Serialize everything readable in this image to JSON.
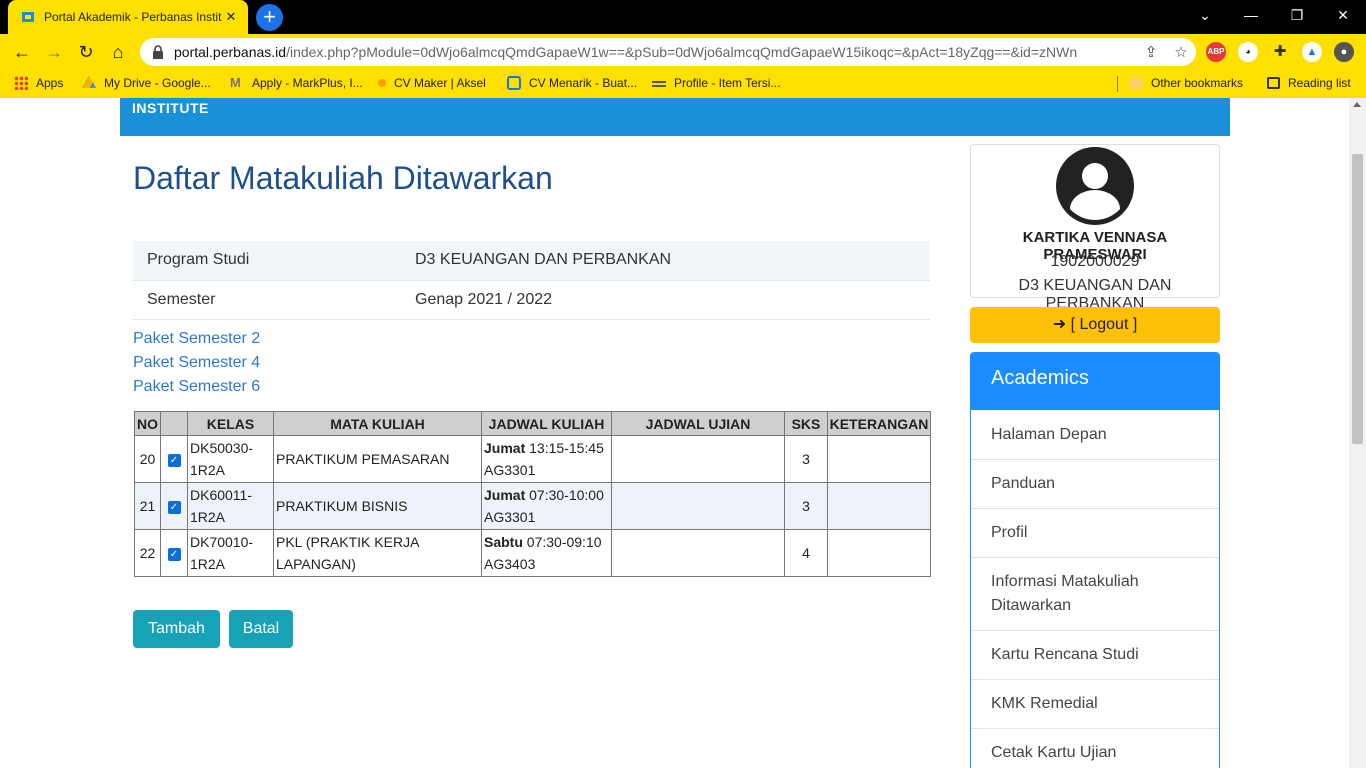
{
  "browser": {
    "tab_title": "Portal Akademik - Perbanas Instit",
    "url_host": "portal.perbanas.id",
    "url_path": "/index.php?pModule=0dWjo6almcqQmdGapaeW1w==&pSub=0dWjo6almcqQmdGapaeW15ikoqc=&pAct=18yZqg==&id=zNWn",
    "bookmarks": [
      {
        "label": "Apps"
      },
      {
        "label": "My Drive - Google..."
      },
      {
        "label": "Apply - MarkPlus, I..."
      },
      {
        "label": "CV Maker | Aksel"
      },
      {
        "label": "CV Menarik - Buat..."
      },
      {
        "label": "Profile - Item Tersi..."
      }
    ],
    "other_bookmarks": "Other bookmarks",
    "reading_list": "Reading list"
  },
  "banner": {
    "logo_text": "INSTITUTE"
  },
  "page": {
    "title": "Daftar Matakuliah Ditawarkan",
    "info": [
      {
        "label": "Program Studi",
        "value": "D3 KEUANGAN DAN PERBANKAN"
      },
      {
        "label": "Semester",
        "value": "Genap 2021 / 2022"
      }
    ],
    "paket_links": [
      "Paket Semester 2",
      "Paket Semester 4",
      "Paket Semester 6"
    ],
    "table": {
      "headers": [
        "NO",
        "",
        "KELAS",
        "MATA KULIAH",
        "JADWAL KULIAH",
        "JADWAL UJIAN",
        "SKS",
        "KETERANGAN"
      ],
      "rows": [
        {
          "no": "20",
          "checked": true,
          "kelas_1": "DK50030-",
          "kelas_2": "1R2A",
          "matkul_1": "PRAKTIKUM PEMASARAN",
          "matkul_2": "",
          "day": "Jumat",
          "time": "13:15-15:45",
          "room": "AG3301",
          "ujian": "",
          "sks": "3",
          "ket": ""
        },
        {
          "no": "21",
          "checked": true,
          "kelas_1": "DK60011-",
          "kelas_2": "1R2A",
          "matkul_1": "PRAKTIKUM BISNIS",
          "matkul_2": "",
          "day": "Jumat",
          "time": "07:30-10:00",
          "room": "AG3301",
          "ujian": "",
          "sks": "3",
          "ket": ""
        },
        {
          "no": "22",
          "checked": true,
          "kelas_1": "DK70010-",
          "kelas_2": "1R2A",
          "matkul_1": "PKL (PRAKTIK KERJA",
          "matkul_2": "LAPANGAN)",
          "day": "Sabtu",
          "time": "07:30-09:10",
          "room": "AG3403",
          "ujian": "",
          "sks": "4",
          "ket": ""
        }
      ]
    },
    "buttons": {
      "tambah": "Tambah",
      "batal": "Batal"
    }
  },
  "profile": {
    "name": "KARTIKA VENNASA PRAMESWARI",
    "nim": "1902000029",
    "program": "D3 KEUANGAN DAN PERBANKAN",
    "logout": "[ Logout ]"
  },
  "academics": {
    "title": "Academics",
    "items": [
      {
        "label": "Halaman Depan"
      },
      {
        "label": "Panduan"
      },
      {
        "label": "Profil"
      },
      {
        "label": "Informasi Matakuliah Ditawarkan"
      },
      {
        "label": "Kartu Rencana Studi"
      },
      {
        "label": "KMK Remedial"
      },
      {
        "label": "Cetak Kartu Ujian"
      }
    ]
  },
  "colors": {
    "chrome": "#ffe000",
    "banner": "#1a90d8",
    "title": "#1e4f8f",
    "link": "#2a7ad6",
    "button": "#17a2b8",
    "logout": "#ffc107",
    "academics": "#1a8cff"
  }
}
